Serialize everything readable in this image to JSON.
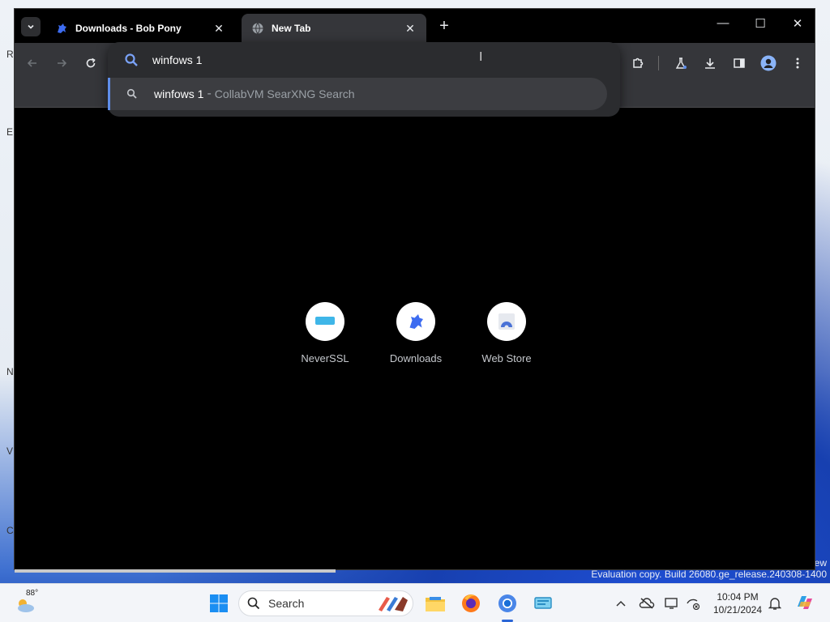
{
  "desktop": {
    "edge_letters": [
      "R",
      "E",
      "N",
      "V",
      "C"
    ],
    "watermark": "Evaluation copy. Build 26080.ge_release.240308-1400",
    "watermark_tail": "ew"
  },
  "browser": {
    "tabs": [
      {
        "title": "Downloads - Bob Pony",
        "icon": "bob-pony-icon",
        "active": false
      },
      {
        "title": "New Tab",
        "icon": "globe-icon",
        "active": true
      }
    ],
    "omnibox": {
      "value": "winfows 1",
      "suggestion": {
        "query": "winfows 1",
        "separator": "-",
        "provider": "CollabVM SearXNG Search"
      }
    },
    "shortcuts": [
      {
        "label": "NeverSSL",
        "icon": "neverssl-icon"
      },
      {
        "label": "Downloads",
        "icon": "bob-pony-icon"
      },
      {
        "label": "Web Store",
        "icon": "web-store-icon"
      }
    ],
    "colors": {
      "tab_active": "#35363a",
      "toolbar": "#35363a",
      "omnibox": "#2b2c2f",
      "suggestion_highlight": "#3c3d41",
      "accent": "#5f8eea",
      "content_bg": "#000000"
    }
  },
  "taskbar": {
    "weather": {
      "temp": "88°",
      "icon": "weather-icon"
    },
    "search_label": "Search",
    "clock": {
      "time": "10:04 PM",
      "date": "10/21/2024"
    }
  }
}
